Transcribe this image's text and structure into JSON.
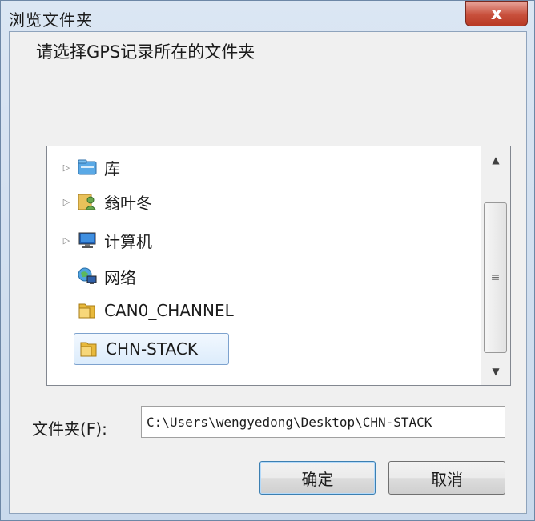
{
  "window": {
    "title": "浏览文件夹",
    "close_glyph": "x"
  },
  "dialog": {
    "prompt": "请选择GPS记录所在的文件夹",
    "tree": [
      {
        "label": "库",
        "icon": "library-icon",
        "expandable": true,
        "selected": false
      },
      {
        "label": "翁叶冬",
        "icon": "user-folder-icon",
        "expandable": true,
        "selected": false
      },
      {
        "label": "计算机",
        "icon": "computer-icon",
        "expandable": true,
        "selected": false
      },
      {
        "label": "网络",
        "icon": "network-icon",
        "expandable": false,
        "selected": false
      },
      {
        "label": "CAN0_CHANNEL",
        "icon": "folder-icon",
        "expandable": false,
        "selected": false
      },
      {
        "label": "CHN-STACK",
        "icon": "folder-icon",
        "expandable": false,
        "selected": true
      }
    ],
    "folder_label": "文件夹(F):",
    "folder_value": "C:\\Users\\wengyedong\\Desktop\\CHN-STACK",
    "ok_label": "确定",
    "cancel_label": "取消"
  }
}
